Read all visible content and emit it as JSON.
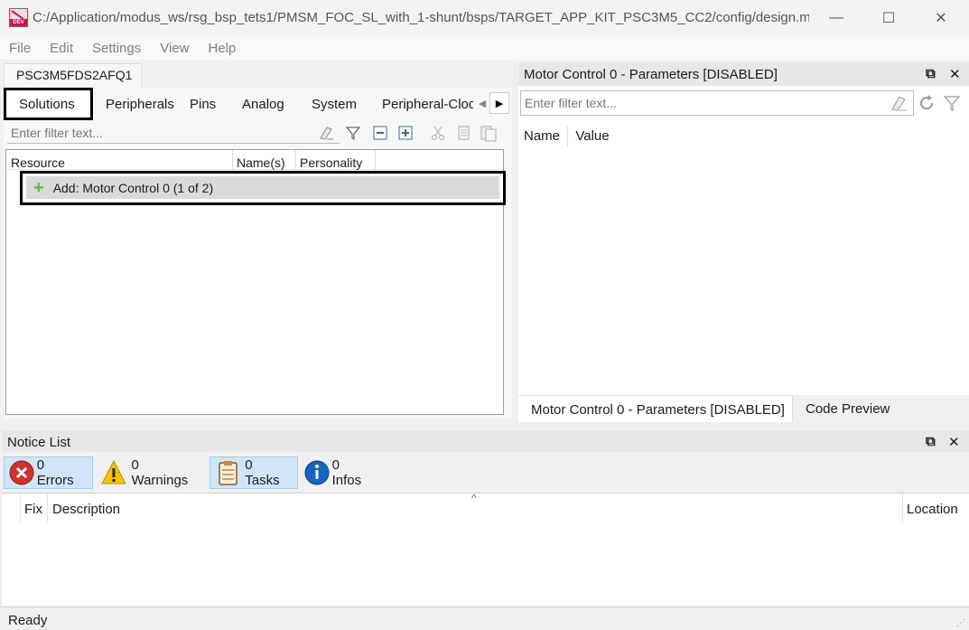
{
  "window": {
    "title": "C:/Application/modus_ws/rsg_bsp_tets1/PMSM_FOC_SL_with_1-shunt/bsps/TARGET_APP_KIT_PSC3M5_CC2/config/design.modu...",
    "icon_label": "DEV",
    "controls": [
      "—",
      "☐",
      "✕"
    ]
  },
  "menu": [
    "File",
    "Edit",
    "Settings",
    "View",
    "Help"
  ],
  "editor": {
    "device_tab": "PSC3M5FDS2AFQ1",
    "tabs": [
      "Solutions",
      "Peripherals",
      "Pins",
      "Analog",
      "System",
      "Peripheral-Cloc"
    ],
    "active_tab": "Solutions",
    "filter_placeholder": "Enter filter text...",
    "tree_columns": [
      "Resource",
      "Name(s)",
      "Personality"
    ],
    "rows": [
      {
        "label": "Add: Motor Control 0 (1 of 2)",
        "icon": "plus-icon",
        "highlighted": true
      }
    ]
  },
  "parameters": {
    "title": "Motor Control 0 - Parameters [DISABLED]",
    "filter_placeholder": "Enter filter text...",
    "columns": [
      "Name",
      "Value"
    ],
    "bottom_tabs": [
      "Motor Control 0 - Parameters [DISABLED]",
      "Code Preview"
    ],
    "active_bottom_tab": "Motor Control 0 - Parameters [DISABLED]"
  },
  "notice_list": {
    "title": "Notice List",
    "filters": [
      {
        "label": "0 Errors",
        "icon": "error-icon",
        "on": true
      },
      {
        "label": "0 Warnings",
        "icon": "warning-icon",
        "on": false
      },
      {
        "label": "0 Tasks",
        "icon": "tasks-icon",
        "on": true
      },
      {
        "label": "0 Infos",
        "icon": "info-icon",
        "on": false
      }
    ],
    "columns": [
      "Fix",
      "Description",
      "Location"
    ]
  },
  "status": "Ready",
  "colors": {
    "accent_selected": "#cfe6f8",
    "error": "#d32f2f",
    "warning": "#f5c400",
    "info": "#1565c0",
    "plus": "#6ab04c"
  }
}
